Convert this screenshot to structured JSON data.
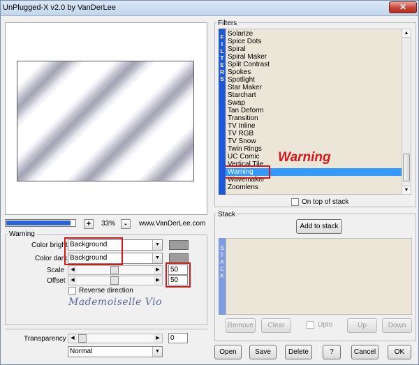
{
  "window": {
    "title": "UnPlugged-X v2.0 by VanDerLee",
    "close_glyph": "✕"
  },
  "preview": {
    "zoom_minus": "-",
    "zoom_plus": "+",
    "zoom_level": "33%",
    "website": "www.VanDerLee.com",
    "progress_fraction": 0.94
  },
  "params": {
    "group_label": "Warning",
    "color_bright_label": "Color bright",
    "color_bright_value": "Background",
    "color_dark_label": "Color dark",
    "color_dark_value": "Background",
    "scale_label": "Scale",
    "scale_value": "50",
    "offset_label": "Offset",
    "offset_value": "50",
    "reverse_label": "Reverse direction",
    "transparency_label": "Transparency",
    "transparency_value": "0",
    "blend_mode_value": "Normal",
    "signature": "Mademoiselle Vio"
  },
  "filters": {
    "group_label": "Filters",
    "strip_label": "FILTERS",
    "items": [
      "Solarize",
      "Spice Dots",
      "Spiral",
      "Spiral Maker",
      "Split Contrast",
      "Spokes",
      "Spotlight",
      "Star Maker",
      "Starchart",
      "Swap",
      "Tan Deform",
      "Transition",
      "TV Inline",
      "TV RGB",
      "TV Snow",
      "Twin Rings",
      "UC Comic",
      "Vertical Tile",
      "Warning",
      "Wavemaker",
      "Zoomlens"
    ],
    "selected": "Warning",
    "annotation": "Warning",
    "on_top_label": "On top of stack"
  },
  "stack": {
    "group_label": "Stack",
    "strip_label": "STACK",
    "add_label": "Add to stack",
    "remove_label": "Remove",
    "clear_label": "Clear",
    "upto_label": "Upto",
    "up_label": "Up",
    "down_label": "Down"
  },
  "footer": {
    "open": "Open",
    "save": "Save",
    "delete": "Delete",
    "help": "?",
    "cancel": "Cancel",
    "ok": "OK"
  },
  "colors": {
    "accent_blue": "#1f58d6",
    "highlight_red": "#d21a1a",
    "list_bg": "#ece6d8"
  }
}
